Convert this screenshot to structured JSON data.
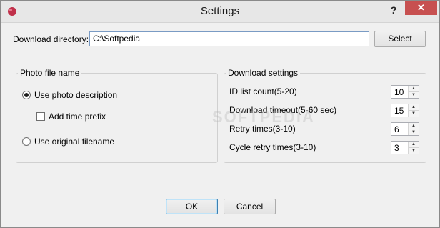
{
  "window": {
    "title": "Settings",
    "help_label": "?",
    "close_label": "✕"
  },
  "download_dir": {
    "label": "Download directory:",
    "value": "C:\\Softpedia",
    "select_label": "Select"
  },
  "photo_file_name": {
    "legend": "Photo file name",
    "use_photo_description": {
      "label": "Use photo description",
      "checked": true
    },
    "add_time_prefix": {
      "label": "Add time prefix",
      "checked": false
    },
    "use_original_filename": {
      "label": "Use original filename",
      "checked": false
    }
  },
  "download_settings": {
    "legend": "Download settings",
    "id_list_count": {
      "label": "ID list count(5-20)",
      "value": "10"
    },
    "download_timeout": {
      "label": "Download timeout(5-60 sec)",
      "value": "15"
    },
    "retry_times": {
      "label": "Retry times(3-10)",
      "value": "6"
    },
    "cycle_retry_times": {
      "label": "Cycle retry times(3-10)",
      "value": "3"
    }
  },
  "footer": {
    "ok_label": "OK",
    "cancel_label": "Cancel"
  },
  "watermark": "SOFTPEDIA"
}
